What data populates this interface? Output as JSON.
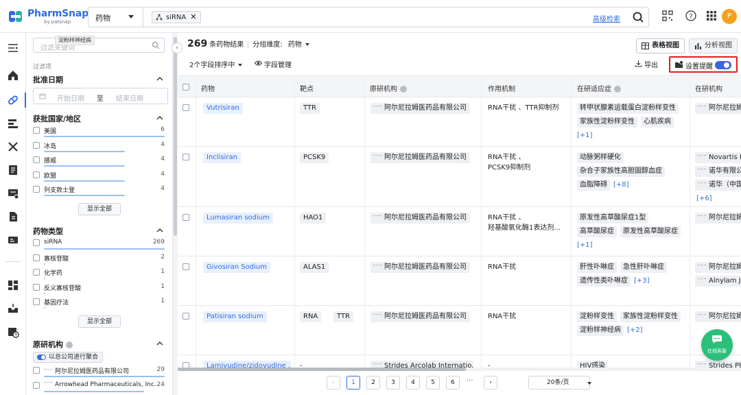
{
  "brand": {
    "name": "PharmSnap",
    "sub": "by patsnap"
  },
  "search": {
    "category": "药物",
    "token": "siRNA",
    "advanced_label": "高级检索"
  },
  "user": {
    "avatar_letter": "P"
  },
  "filters": {
    "keyword_placeholder": "过滤关键词",
    "tooltip": "淀粉样神经病",
    "section_label": "过滤项",
    "approval_date": {
      "title": "批准日期",
      "start_placeholder": "开始日期",
      "sep": "至",
      "end_placeholder": "结束日期"
    },
    "country": {
      "title": "获批国家/地区",
      "items": [
        {
          "name": "美国",
          "count": "6",
          "share": 1.0
        },
        {
          "name": "冰岛",
          "count": "4",
          "share": 0.67
        },
        {
          "name": "挪威",
          "count": "4",
          "share": 0.67
        },
        {
          "name": "欧盟",
          "count": "4",
          "share": 0.67
        },
        {
          "name": "列支敦士登",
          "count": "4",
          "share": 0.67
        }
      ],
      "show_all": "显示全部"
    },
    "drug_type": {
      "title": "药物类型",
      "items": [
        {
          "name": "siRNA",
          "count": "269",
          "share": 1.0
        },
        {
          "name": "寡核苷酸",
          "count": "2",
          "share": 0.01
        },
        {
          "name": "化学药",
          "count": "1",
          "share": 0.005
        },
        {
          "name": "反义寡核苷酸",
          "count": "1",
          "share": 0.005
        },
        {
          "name": "基因疗法",
          "count": "1",
          "share": 0.005
        }
      ],
      "show_all": "显示全部"
    },
    "originator": {
      "title": "原研机构",
      "toggle_label": "以总公司进行聚合",
      "items": [
        {
          "name": "阿尔尼拉姆医药品有限公司",
          "count": "29",
          "share": 1.0
        },
        {
          "name": "Arrowhead Pharmaceuticals, Inc.",
          "count": "24",
          "share": 0.83
        }
      ]
    }
  },
  "results": {
    "count": "269",
    "count_suffix": "条药物结果",
    "group_label": "分组维度:",
    "group_value": "药物",
    "sort_label": "2个字段排序中",
    "field_manage": "字段管理",
    "export": "导出",
    "alert_label": "设置提醒",
    "views": {
      "table": "表格视图",
      "analysis": "分析视图"
    }
  },
  "table": {
    "columns": [
      "药物",
      "靶点",
      "原研机构",
      "作用机制",
      "在研适应症",
      "在研机构"
    ],
    "rows": [
      {
        "drug": "Vutrisiran",
        "targets": [
          "TTR"
        ],
        "originator": "阿尔尼拉姆医药品有限公司",
        "mechanism": [
          "RNA干扰 、TTR抑制剂"
        ],
        "indications": [
          "转甲状腺素运载蛋白淀粉样变性",
          "家族性淀粉样变性",
          "心肌疾病"
        ],
        "more": "[+1]",
        "orgs": [
          "阿尔尼拉姆"
        ]
      },
      {
        "drug": "Inclisiran",
        "targets": [
          "PCSK9"
        ],
        "originator": "阿尔尼拉姆医药品有限公司",
        "mechanism": [
          "RNA干扰 、",
          "PCSK9抑制剂"
        ],
        "indications": [
          "动脉粥样硬化",
          "杂合子家族性高胆固醇血症",
          "血脂障碍"
        ],
        "more": "[+8]",
        "orgs": [
          "Novartis P",
          "诺华有限公",
          "诺华（中国"
        ],
        "orgs_more": "[+6]"
      },
      {
        "drug": "Lumasiran sodium",
        "targets": [
          "HAO1"
        ],
        "originator": "阿尔尼拉姆医药品有限公司",
        "mechanism": [
          "RNA干扰 、",
          "羟基酸氧化酶1表达剂..."
        ],
        "indications": [
          "原发性高草酸尿症1型",
          "高草酸尿症",
          "原发性高草酸尿症"
        ],
        "more": "[+1]",
        "orgs": [
          "阿尔尼拉姆"
        ]
      },
      {
        "drug": "Givosiran Sodium",
        "targets": [
          "ALAS1"
        ],
        "originator": "阿尔尼拉姆医药品有限公司",
        "mechanism": [
          "RNA干扰"
        ],
        "indications": [
          "肝性卟啉症",
          "急性肝卟啉症",
          "遗传性类卟啉症"
        ],
        "more": "[+3]",
        "orgs": [
          "阿尔尼拉姆",
          "Alnylam J"
        ]
      },
      {
        "drug": "Patisiran sodium",
        "targets": [
          "RNA",
          "TTR"
        ],
        "originator": "阿尔尼拉姆医药品有限公司",
        "mechanism": [
          "RNA干扰"
        ],
        "indications": [
          "淀粉样变性",
          "家族性淀粉样变性",
          "淀粉样神经病"
        ],
        "more": "[+2]",
        "orgs": [
          "阿尔尼拉姆"
        ]
      },
      {
        "drug": "Lamivudine/zidovudine ...",
        "targets": [
          "-"
        ],
        "originator": "Strides Arcolab Internatio...",
        "mechanism": [
          "-"
        ],
        "indications": [
          "HIV感染"
        ],
        "orgs": [
          "Strides Ph"
        ]
      }
    ]
  },
  "pagination": {
    "pages": [
      "1",
      "2",
      "3",
      "4",
      "5",
      "6"
    ],
    "ellipsis": "···",
    "page_size": "20条/页"
  },
  "chat": {
    "label": "在线客服"
  },
  "colors": {
    "accent": "#2f6ce0",
    "alert_border": "#e21d1d",
    "chat": "#2bbf7a"
  }
}
